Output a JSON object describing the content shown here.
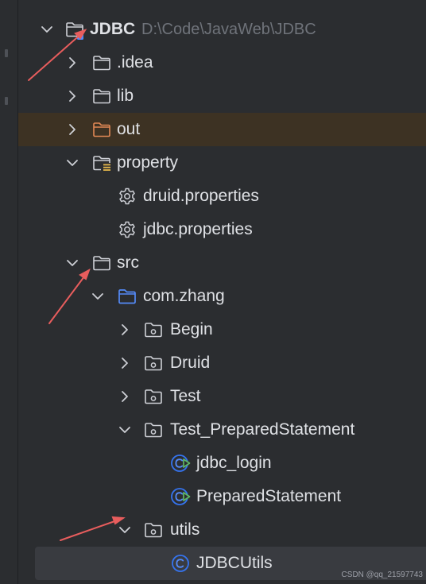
{
  "tree": {
    "root": {
      "label": "JDBC",
      "path": "D:\\Code\\JavaWeb\\JDBC"
    },
    "items": [
      {
        "label": ".idea"
      },
      {
        "label": "lib"
      },
      {
        "label": "out"
      },
      {
        "label": "property"
      },
      {
        "label": "druid.properties"
      },
      {
        "label": "jdbc.properties"
      },
      {
        "label": "src"
      },
      {
        "label": "com.zhang"
      },
      {
        "label": "Begin"
      },
      {
        "label": "Druid"
      },
      {
        "label": "Test"
      },
      {
        "label": "Test_PreparedStatement"
      },
      {
        "label": "jdbc_login"
      },
      {
        "label": "PreparedStatement"
      },
      {
        "label": "utils"
      },
      {
        "label": "JDBCUtils"
      }
    ]
  },
  "colors": {
    "background": "#2b2d30",
    "excluded_row": "#3d3223",
    "selected_row": "#393b40",
    "package_blue": "#548af7",
    "class_blue": "#3574f0",
    "run_green": "#5fb865",
    "annotation_arrow": "#e85d5d"
  },
  "icons": {
    "expand": "chevron-down-icon",
    "collapse": "chevron-right-icon",
    "folder": "folder-icon",
    "excluded_folder": "excluded-folder-icon",
    "resource_folder": "resource-folder-icon",
    "package": "package-icon",
    "settings": "gear-icon",
    "class": "class-icon",
    "runnable_class": "runnable-class-icon"
  },
  "watermark": "CSDN @qq_21597743"
}
